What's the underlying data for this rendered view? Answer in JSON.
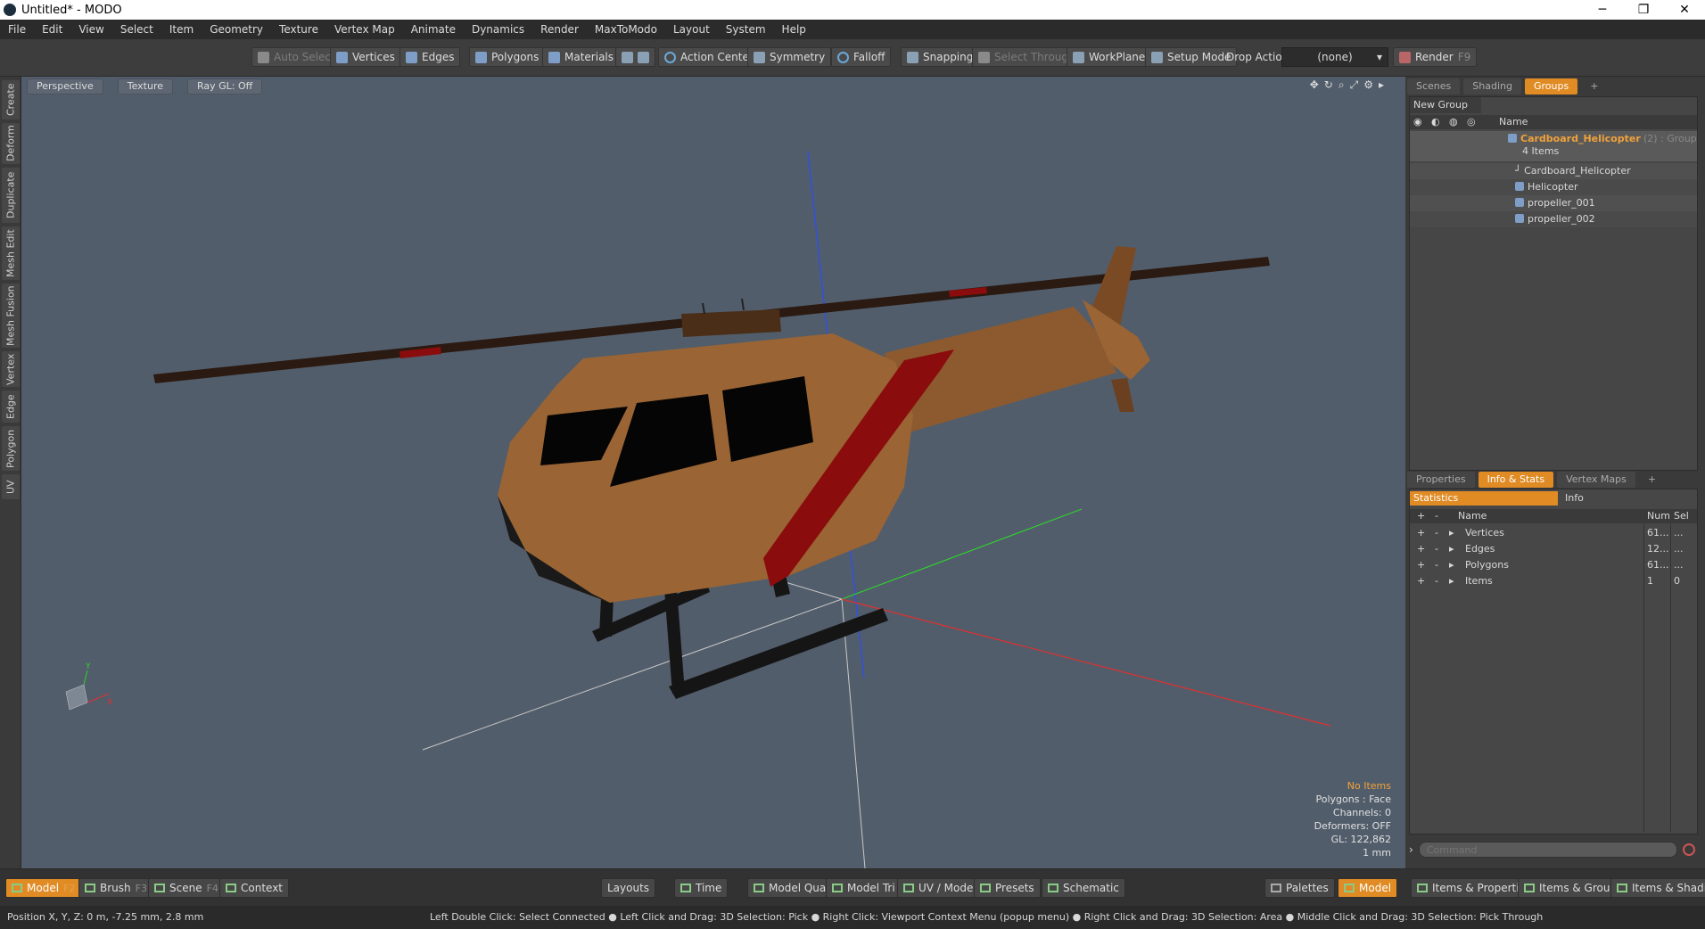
{
  "window": {
    "title": "Untitled* - MODO",
    "controls": [
      "─",
      "❐",
      "✕"
    ]
  },
  "menu": [
    "File",
    "Edit",
    "View",
    "Select",
    "Item",
    "Geometry",
    "Texture",
    "Vertex Map",
    "Animate",
    "Dynamics",
    "Render",
    "MaxToModo",
    "Layout",
    "System",
    "Help"
  ],
  "toolbar": {
    "auto_select": "Auto Select",
    "vertices": "Vertices",
    "edges": "Edges",
    "polygons": "Polygons",
    "materials": "Materials",
    "action_center": "Action Center",
    "symmetry": "Symmetry",
    "falloff": "Falloff",
    "snapping": "Snapping",
    "select_through": "Select Through",
    "workplane": "WorkPlane",
    "setup_mode": "Setup Mode",
    "drop_action": "Drop Action",
    "drop_value": "(none)",
    "render": "Render",
    "render_key": "F9"
  },
  "left_tabs": [
    "Create",
    "Deform",
    "Duplicate",
    "Mesh Edit",
    "Mesh Fusion",
    "Vertex",
    "Edge",
    "Polygon",
    "UV"
  ],
  "viewport": {
    "view": "Perspective",
    "shading": "Texture",
    "raygl": "Ray GL: Off",
    "info": {
      "no_items": "No Items",
      "polygons": "Polygons : Face",
      "channels": "Channels: 0",
      "deformers": "Deformers: OFF",
      "gl": "GL: 122,862",
      "unit": "1 mm"
    },
    "axes": {
      "y": "Y",
      "x": "X"
    },
    "colors": {
      "body": "#9a6434",
      "stripe": "#8a0c0c",
      "skid": "#151515",
      "x_axis": "#e03030",
      "y_axis": "#30d030",
      "z_axis": "#3050e0"
    }
  },
  "groups_panel": {
    "tabs": [
      "Scenes",
      "Shading",
      "Groups"
    ],
    "active_tab": "Groups",
    "new_group": "New Group",
    "col_name": "Name",
    "group_name": "Cardboard_Helicopter",
    "group_suffix": "(2) : Group",
    "group_count": "4 Items",
    "items": [
      "Cardboard_Helicopter",
      "Helicopter",
      "propeller_001",
      "propeller_002"
    ]
  },
  "stats_panel": {
    "tabs": [
      "Properties",
      "Info & Stats",
      "Vertex Maps"
    ],
    "active_tab": "Info & Stats",
    "sub_tabs": [
      "Statistics",
      "Info"
    ],
    "cols": {
      "name": "Name",
      "num": "Num",
      "sel": "Sel"
    },
    "rows": [
      {
        "name": "Vertices",
        "num": "61...",
        "sel": "..."
      },
      {
        "name": "Edges",
        "num": "12...",
        "sel": "..."
      },
      {
        "name": "Polygons",
        "num": "61...",
        "sel": "..."
      },
      {
        "name": "Items",
        "num": "1",
        "sel": "0"
      }
    ],
    "command_placeholder": "Command"
  },
  "bottom_bar": {
    "model": "Model",
    "model_key": "F2",
    "brush": "Brush",
    "brush_key": "F3",
    "scene": "Scene",
    "scene_key": "F4",
    "context": "Context",
    "layouts": "Layouts",
    "time": "Time",
    "model_quad": "Model Quad",
    "model_tri": "Model Tri",
    "uv_model": "UV / Model",
    "presets": "Presets",
    "schematic": "Schematic",
    "palettes": "Palettes",
    "model2": "Model",
    "items_props": "Items & Properties",
    "items_groups": "Items & Groups",
    "items_shading": "Items & Shading"
  },
  "status": {
    "position": "Position X, Y, Z:   0 m, -7.25 mm, 2.8 mm",
    "hints": "Left Double Click: Select Connected ● Left Click and Drag: 3D Selection: Pick ● Right Click: Viewport Context Menu (popup menu) ● Right Click and Drag: 3D Selection: Area ● Middle Click and Drag: 3D Selection: Pick Through"
  }
}
